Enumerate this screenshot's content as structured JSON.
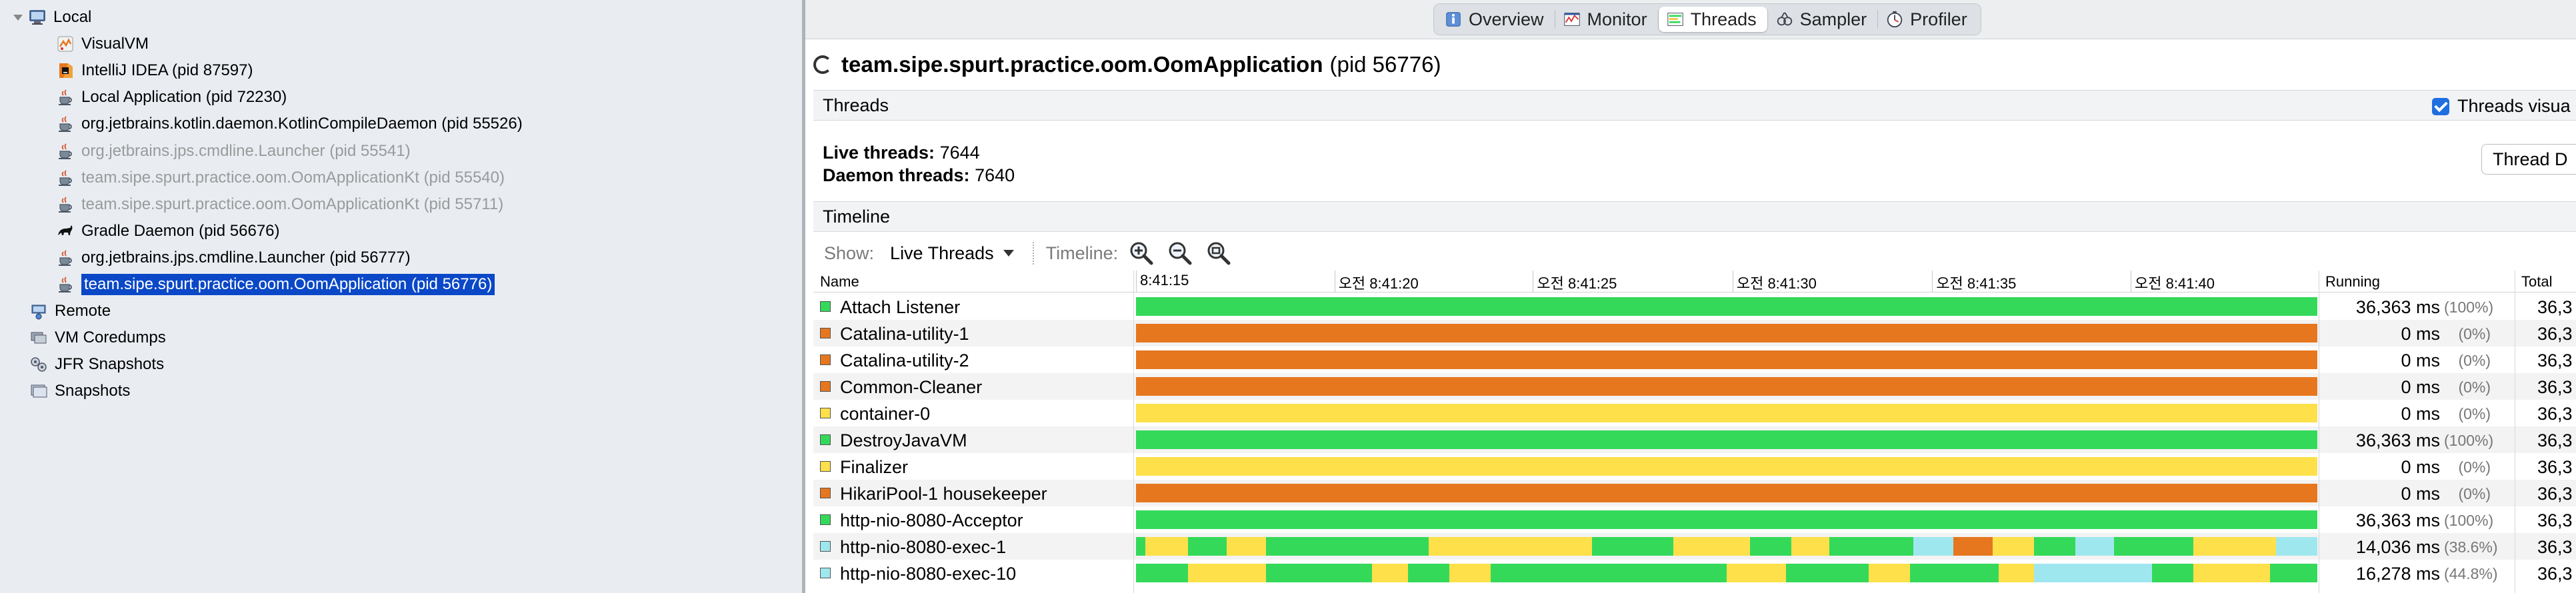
{
  "colors": {
    "running": "#34d95a",
    "sleeping": "#e6771f",
    "wait": "#fde04a",
    "park": "#f6c23e",
    "monitor": "#9fe7ef",
    "selection": "#0b48c8"
  },
  "tree": [
    {
      "label": "Local",
      "icon": "computer-icon",
      "depth": 0,
      "twisty": true
    },
    {
      "label": "VisualVM",
      "icon": "visualvm-icon",
      "depth": 1
    },
    {
      "label": "IntelliJ IDEA (pid 87597)",
      "icon": "intellij-icon",
      "depth": 1
    },
    {
      "label": "Local Application (pid 72230)",
      "icon": "java-cup-icon",
      "depth": 1
    },
    {
      "label": "org.jetbrains.kotlin.daemon.KotlinCompileDaemon (pid 55526)",
      "icon": "java-cup-icon",
      "depth": 1
    },
    {
      "label": "org.jetbrains.jps.cmdline.Launcher (pid 55541)",
      "icon": "java-cup-icon",
      "depth": 1,
      "disabled": true
    },
    {
      "label": "team.sipe.spurt.practice.oom.OomApplicationKt (pid 55540)",
      "icon": "java-cup-icon",
      "depth": 1,
      "disabled": true
    },
    {
      "label": "team.sipe.spurt.practice.oom.OomApplicationKt (pid 55711)",
      "icon": "java-cup-icon",
      "depth": 1,
      "disabled": true
    },
    {
      "label": "Gradle Daemon (pid 56676)",
      "icon": "gradle-icon",
      "depth": 1
    },
    {
      "label": "org.jetbrains.jps.cmdline.Launcher (pid 56777)",
      "icon": "java-cup-icon",
      "depth": 1
    },
    {
      "label": "team.sipe.spurt.practice.oom.OomApplication (pid 56776)",
      "icon": "java-cup-icon",
      "depth": 1,
      "selected": true
    },
    {
      "label": "Remote",
      "icon": "remote-host-icon",
      "depth": 0
    },
    {
      "label": "VM Coredumps",
      "icon": "coredump-icon",
      "depth": 0
    },
    {
      "label": "JFR Snapshots",
      "icon": "jfr-icon",
      "depth": 0
    },
    {
      "label": "Snapshots",
      "icon": "snapshot-icon",
      "depth": 0
    }
  ],
  "tabs": [
    {
      "label": "Overview",
      "icon": "overview-icon"
    },
    {
      "label": "Monitor",
      "icon": "monitor-icon"
    },
    {
      "label": "Threads",
      "icon": "threads-icon",
      "active": true
    },
    {
      "label": "Sampler",
      "icon": "sampler-icon"
    },
    {
      "label": "Profiler",
      "icon": "profiler-icon"
    }
  ],
  "app": {
    "name": "team.sipe.spurt.practice.oom.OomApplication",
    "pid": "(pid 56776)"
  },
  "threads_section": {
    "title": "Threads",
    "visualization_label": "Threads visua",
    "live_label": "Live threads:",
    "live_value": "7644",
    "daemon_label": "Daemon threads:",
    "daemon_value": "7640",
    "thread_dump_label": "Thread D"
  },
  "timeline": {
    "title": "Timeline",
    "show_label": "Show:",
    "show_value": "Live Threads",
    "timeline_label": "Timeline:",
    "zoom_in": "zoom-in-icon",
    "zoom_out": "zoom-out-icon",
    "zoom_fit": "zoom-fit-icon"
  },
  "columns": {
    "name": "Name",
    "running": "Running",
    "total": "Total"
  },
  "time_ticks": [
    "8:41:15",
    "오전 8:41:20",
    "오전 8:41:25",
    "오전 8:41:30",
    "오전 8:41:35",
    "오전 8:41:40"
  ],
  "threads": [
    {
      "name": "Attach Listener",
      "state": "running",
      "running": "36,363 ms",
      "pct": "(100%)",
      "total": "36,3",
      "segments": [
        [
          0,
          1,
          "running"
        ]
      ]
    },
    {
      "name": "Catalina-utility-1",
      "state": "sleeping",
      "running": "0 ms",
      "pct": "(0%)",
      "total": "36,3",
      "segments": [
        [
          0,
          1,
          "sleeping"
        ]
      ]
    },
    {
      "name": "Catalina-utility-2",
      "state": "sleeping",
      "running": "0 ms",
      "pct": "(0%)",
      "total": "36,3",
      "segments": [
        [
          0,
          1,
          "sleeping"
        ]
      ]
    },
    {
      "name": "Common-Cleaner",
      "state": "sleeping",
      "running": "0 ms",
      "pct": "(0%)",
      "total": "36,3",
      "segments": [
        [
          0,
          1,
          "sleeping"
        ]
      ]
    },
    {
      "name": "container-0",
      "state": "wait",
      "running": "0 ms",
      "pct": "(0%)",
      "total": "36,3",
      "segments": [
        [
          0,
          1,
          "wait"
        ]
      ]
    },
    {
      "name": "DestroyJavaVM",
      "state": "running",
      "running": "36,363 ms",
      "pct": "(100%)",
      "total": "36,3",
      "segments": [
        [
          0,
          1,
          "running"
        ]
      ]
    },
    {
      "name": "Finalizer",
      "state": "wait",
      "running": "0 ms",
      "pct": "(0%)",
      "total": "36,3",
      "segments": [
        [
          0,
          1,
          "wait"
        ]
      ]
    },
    {
      "name": "HikariPool-1 housekeeper",
      "state": "sleeping",
      "running": "0 ms",
      "pct": "(0%)",
      "total": "36,3",
      "segments": [
        [
          0,
          1,
          "sleeping"
        ]
      ]
    },
    {
      "name": "http-nio-8080-Acceptor",
      "state": "running",
      "running": "36,363 ms",
      "pct": "(100%)",
      "total": "36,3",
      "segments": [
        [
          0,
          1,
          "running"
        ]
      ]
    },
    {
      "name": "http-nio-8080-exec-1",
      "state": "monitor",
      "running": "14,036 ms",
      "pct": "(38.6%)",
      "total": "36,3",
      "segments": [
        [
          0,
          0.008,
          "running"
        ],
        [
          0.008,
          0.044,
          "wait"
        ],
        [
          0.044,
          0.077,
          "running"
        ],
        [
          0.077,
          0.11,
          "wait"
        ],
        [
          0.11,
          0.248,
          "running"
        ],
        [
          0.248,
          0.386,
          "wait"
        ],
        [
          0.386,
          0.455,
          "running"
        ],
        [
          0.455,
          0.52,
          "wait"
        ],
        [
          0.52,
          0.555,
          "running"
        ],
        [
          0.555,
          0.587,
          "wait"
        ],
        [
          0.587,
          0.658,
          "running"
        ],
        [
          0.658,
          0.692,
          "monitor"
        ],
        [
          0.692,
          0.725,
          "sleeping"
        ],
        [
          0.725,
          0.76,
          "wait"
        ],
        [
          0.76,
          0.795,
          "running"
        ],
        [
          0.795,
          0.828,
          "monitor"
        ],
        [
          0.828,
          0.895,
          "running"
        ],
        [
          0.895,
          0.965,
          "wait"
        ],
        [
          0.965,
          1,
          "monitor"
        ]
      ]
    },
    {
      "name": "http-nio-8080-exec-10",
      "state": "monitor",
      "running": "16,278 ms",
      "pct": "(44.8%)",
      "total": "36,3",
      "segments": [
        [
          0,
          0.008,
          "running"
        ],
        [
          0.008,
          0.044,
          "running"
        ],
        [
          0.044,
          0.11,
          "wait"
        ],
        [
          0.11,
          0.2,
          "running"
        ],
        [
          0.2,
          0.23,
          "wait"
        ],
        [
          0.23,
          0.265,
          "running"
        ],
        [
          0.265,
          0.3,
          "wait"
        ],
        [
          0.3,
          0.386,
          "running"
        ],
        [
          0.386,
          0.5,
          "running"
        ],
        [
          0.5,
          0.55,
          "wait"
        ],
        [
          0.55,
          0.62,
          "running"
        ],
        [
          0.62,
          0.655,
          "wait"
        ],
        [
          0.655,
          0.73,
          "running"
        ],
        [
          0.73,
          0.76,
          "wait"
        ],
        [
          0.76,
          0.86,
          "monitor"
        ],
        [
          0.86,
          0.895,
          "running"
        ],
        [
          0.895,
          0.96,
          "wait"
        ],
        [
          0.96,
          1,
          "running"
        ]
      ]
    }
  ]
}
